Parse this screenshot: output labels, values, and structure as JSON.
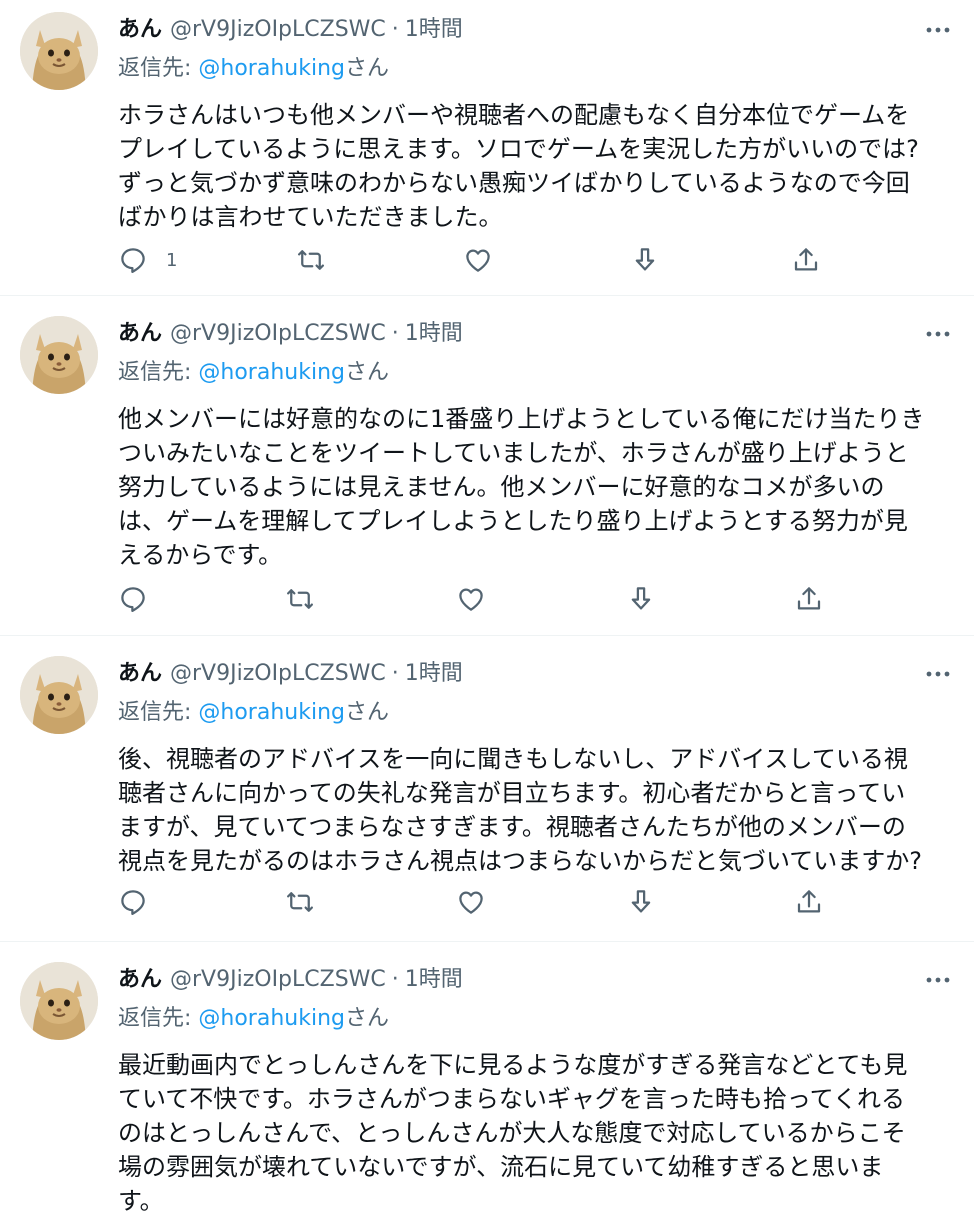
{
  "tweets": [
    {
      "name": "あん",
      "handle": "@rV9JizOIpLCZSWC",
      "separator": "·",
      "time": "1時間",
      "reply_prefix": "返信先: ",
      "reply_to": "@horahuking",
      "reply_suffix": "さん",
      "text": "ホラさんはいつも他メンバーや視聴者への配慮もなく自分本位でゲームを\nプレイしているように思えます。ソロでゲームを実況した方がいいのでは?\nずっと気づかず意味のわからない愚痴ツイばかりしているようなので今回\nばかりは言わせていただきました。",
      "reply_count": "1"
    },
    {
      "name": "あん",
      "handle": "@rV9JizOIpLCZSWC",
      "separator": "·",
      "time": "1時間",
      "reply_prefix": "返信先: ",
      "reply_to": "@horahuking",
      "reply_suffix": "さん",
      "text": "他メンバーには好意的なのに1番盛り上げようとしている俺にだけ当たりき\nついみたいなことをツイートしていましたが、ホラさんが盛り上げようと\n努力しているようには見えません。他メンバーに好意的なコメが多いの\nは、ゲームを理解してプレイしようとしたり盛り上げようとする努力が見\nえるからです。",
      "reply_count": ""
    },
    {
      "name": "あん",
      "handle": "@rV9JizOIpLCZSWC",
      "separator": "·",
      "time": "1時間",
      "reply_prefix": "返信先: ",
      "reply_to": "@horahuking",
      "reply_suffix": "さん",
      "text": "後、視聴者のアドバイスを一向に聞きもしないし、アドバイスしている視\n聴者さんに向かっての失礼な発言が目立ちます。初心者だからと言ってい\nますが、見ていてつまらなさすぎます。視聴者さんたちが他のメンバーの\n視点を見たがるのはホラさん視点はつまらないからだと気づいていますか?",
      "reply_count": ""
    },
    {
      "name": "あん",
      "handle": "@rV9JizOIpLCZSWC",
      "separator": "·",
      "time": "1時間",
      "reply_prefix": "返信先: ",
      "reply_to": "@horahuking",
      "reply_suffix": "さん",
      "text": "最近動画内でとっしんさんを下に見るような度がすぎる発言などとても見\nていて不快です。ホラさんがつまらないギャグを言った時も拾ってくれる\nのはとっしんさんで、とっしんさんが大人な態度で対応しているからこそ\n場の雰囲気が壊れていないですが、流石に見ていて幼稚すぎると思いま\nす。",
      "reply_count": ""
    }
  ],
  "icons": {
    "more": "more-dots-icon",
    "reply": "reply-bubble-icon",
    "retweet": "retweet-icon",
    "like": "heart-icon",
    "download": "download-arrow-icon",
    "share": "share-upload-icon"
  },
  "colors": {
    "text": "#0f1419",
    "muted": "#536471",
    "link": "#1d9bf0",
    "divider": "#eff3f4"
  }
}
